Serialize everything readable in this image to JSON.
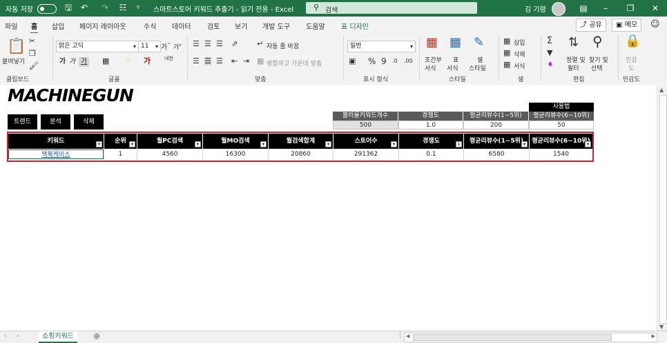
{
  "titlebar": {
    "autosave_label": "자동 저장",
    "toggle_state": "끔",
    "doc_title": "스마트스토어 키워드 추출기 - 읽기 전용 - Excel",
    "search_placeholder": "검색",
    "user_name": "김 기령"
  },
  "tabs": [
    "파일",
    "홈",
    "삽입",
    "페이지 레이아웃",
    "수식",
    "데이터",
    "검토",
    "보기",
    "개발 도구",
    "도움말",
    "표 디자인"
  ],
  "active_tab": "홈",
  "share_label": "공유",
  "memo_label": "메모",
  "ribbon": {
    "clipboard": {
      "paste": "붙여넣기",
      "group": "클립보드"
    },
    "font": {
      "name": "맑은 고딕",
      "size": "11",
      "group": "글꼴",
      "bold": "가",
      "italic": "가",
      "underline": "가",
      "phonetic": "내천"
    },
    "align": {
      "wrap": "자동 줄 바꿈",
      "merge": "병합하고 가운데 맞춤",
      "group": "맞춤"
    },
    "number": {
      "format": "일반",
      "group": "표시 형식"
    },
    "styles": {
      "cond": "조건부",
      "cond2": "서식",
      "table": "표",
      "table2": "서식",
      "cell": "셀",
      "cell2": "스타일",
      "group": "스타일"
    },
    "cells": {
      "insert": "삽입",
      "delete": "삭제",
      "format": "서식",
      "group": "셀"
    },
    "edit": {
      "sort": "정렬 및",
      "sort2": "필터",
      "find": "찾기 및",
      "find2": "선택",
      "group": "편집"
    },
    "sensitivity": {
      "label": "민감",
      "label2": "도",
      "group": "민감도"
    }
  },
  "sheet": {
    "logo": "MACHINEGUN",
    "buttons": [
      "트렌드",
      "분석",
      "삭제"
    ],
    "top_right_header": "사용법",
    "settings": {
      "headers": [
        "불러올키워드개수",
        "경쟁도",
        "평균리뷰수(1~5위)",
        "평균리뷰수(6~10위)"
      ],
      "values": [
        "500",
        "1.0",
        "200",
        "50"
      ]
    },
    "table": {
      "headers": [
        "키워드",
        "순위",
        "월PC검색",
        "월MO검색",
        "월검색합계",
        "스토어수",
        "경쟁도",
        "평균리뷰수(1~5위)",
        "평균리뷰수(6~10위)"
      ],
      "row": [
        "맥북케이스",
        "1",
        "4560",
        "16300",
        "20860",
        "291362",
        "0.1",
        "6580",
        "1540"
      ]
    }
  },
  "sheet_tab": "쇼핑키워드",
  "colors": {
    "excel_green": "#217346",
    "highlight_red": "#d0202e"
  }
}
